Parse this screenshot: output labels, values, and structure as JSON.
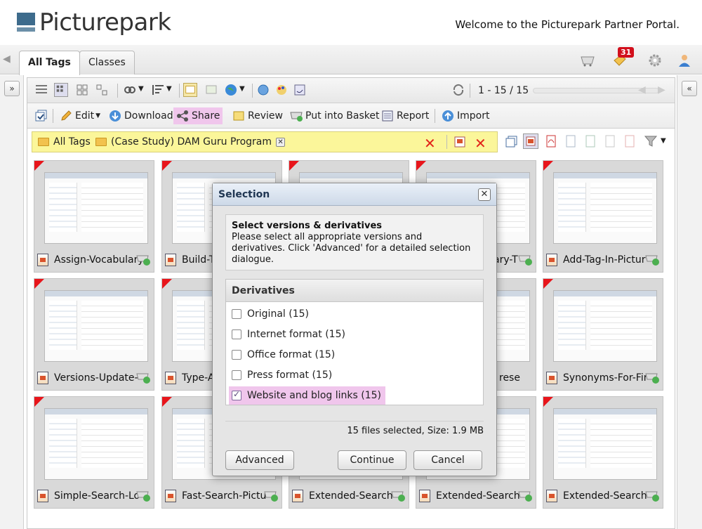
{
  "header": {
    "logo_text": "Picturepark",
    "welcome": "Welcome to the Picturepark Partner Portal."
  },
  "tabs": [
    {
      "label": "All Tags",
      "active": true
    },
    {
      "label": "Classes",
      "active": false
    }
  ],
  "notifications": {
    "count": "31"
  },
  "toolbar": {
    "pager": "1 - 15 / 15",
    "actions": {
      "edit": "Edit",
      "download": "Download",
      "share": "Share",
      "review": "Review",
      "basket": "Put into Basket",
      "report": "Report",
      "import": "Import"
    }
  },
  "filter": {
    "crumb1": "All Tags",
    "crumb2": "(Case Study) DAM Guru Program"
  },
  "grid": {
    "captions": [
      "Assign-Vocabulary",
      "Build-T",
      "",
      "ary-T",
      "Add-Tag-In-Pictur",
      "Versions-Update-",
      "Type-A",
      "",
      "rese",
      "Synonyms-For-Fir",
      "Simple-Search-Lo",
      "Fast-Search-Pictu",
      "Extended-Search-",
      "Extended-Search-",
      "Extended-Search-"
    ]
  },
  "modal": {
    "title": "Selection",
    "info_heading": "Select versions & derivatives",
    "info_text": "Please select all appropriate versions and derivatives. Click 'Advanced' for a detailed selection dialogue.",
    "derivatives_heading": "Derivatives",
    "options": [
      {
        "label": "Original (15)",
        "checked": false
      },
      {
        "label": "Internet format (15)",
        "checked": false
      },
      {
        "label": "Office format (15)",
        "checked": false
      },
      {
        "label": "Press format (15)",
        "checked": false
      },
      {
        "label": "Website and blog links (15)",
        "checked": true
      }
    ],
    "status": "15 files selected, Size: 1.9 MB",
    "buttons": {
      "advanced": "Advanced",
      "continue": "Continue",
      "cancel": "Cancel"
    }
  },
  "colors": {
    "highlight": "#f0c6ec",
    "filter_bg": "#fbf69a",
    "badge": "#d20f1c"
  }
}
